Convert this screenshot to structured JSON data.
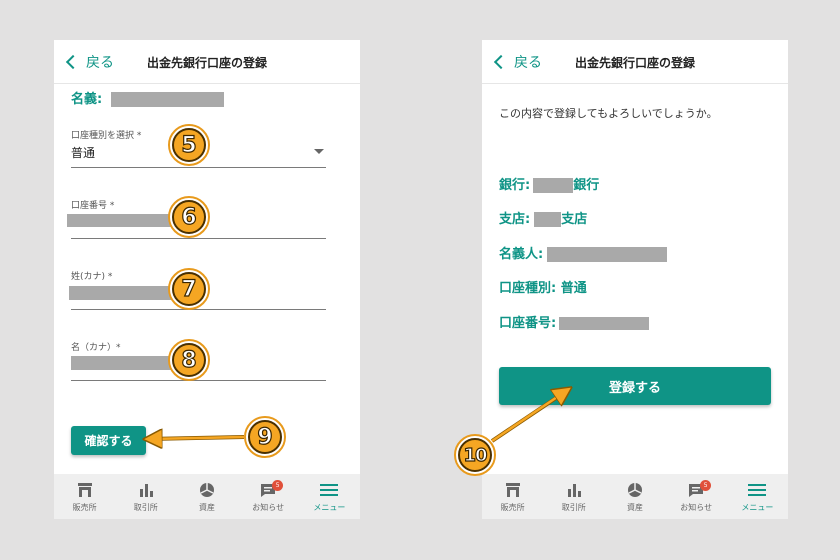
{
  "left": {
    "header": {
      "back_label": "戻る",
      "title": "出金先銀行口座の登録"
    },
    "holder_label": "名義:",
    "fields": {
      "account_type_label": "口座種別を選択 *",
      "account_type_value": "普通",
      "account_number_label": "口座番号 *",
      "last_name_label": "姓(カナ) *",
      "first_name_label": "名（カナ）*"
    },
    "confirm_button": "確認する"
  },
  "right": {
    "header": {
      "back_label": "戻る",
      "title": "出金先銀行口座の登録"
    },
    "prompt": "この内容で登録してもよろしいでしょうか。",
    "bank_label": "銀行:",
    "bank_suffix": "銀行",
    "branch_label": "支店:",
    "branch_suffix": "支店",
    "holder_label": "名義人:",
    "type_label": "口座種別: 普通",
    "number_label": "口座番号:",
    "register_button": "登録する"
  },
  "nav": {
    "items": [
      {
        "label": "販売所",
        "icon": "store-icon"
      },
      {
        "label": "取引所",
        "icon": "bar-chart-icon"
      },
      {
        "label": "資産",
        "icon": "pie-chart-icon"
      },
      {
        "label": "お知らせ",
        "icon": "message-icon",
        "badge": "5"
      },
      {
        "label": "メニュー",
        "icon": "menu-icon",
        "active": true
      }
    ]
  },
  "markers": [
    "5",
    "6",
    "7",
    "8",
    "9",
    "10"
  ],
  "colors": {
    "accent": "#0f9486",
    "marker": "#f5a623",
    "badge": "#e0503a",
    "redaction": "#a9a9a9"
  }
}
